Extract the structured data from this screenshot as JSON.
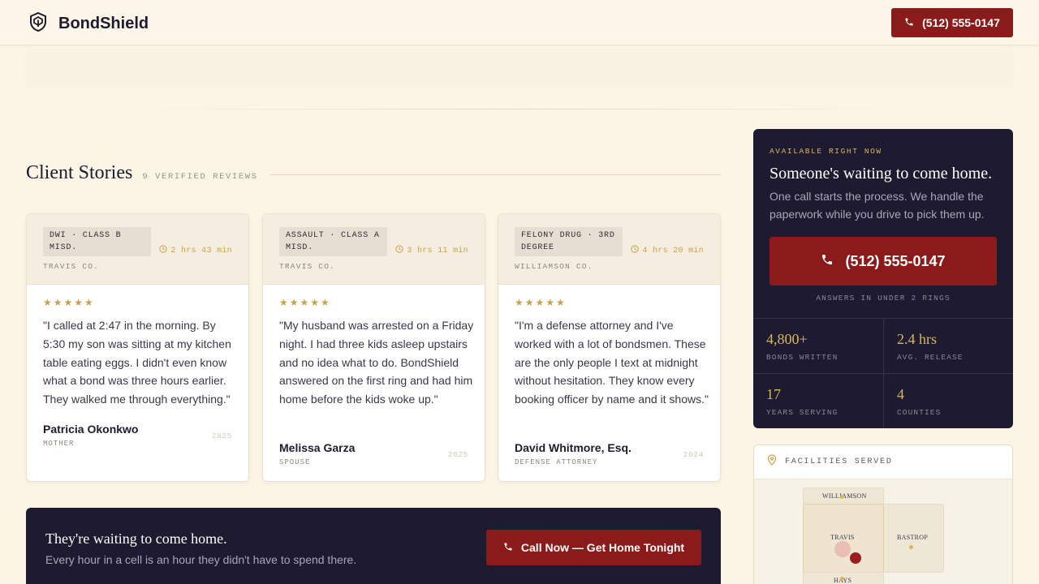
{
  "header": {
    "brand": "BondShield",
    "phone": "(512) 555-0147"
  },
  "reviews": {
    "title": "Client Stories",
    "count": "9 VERIFIED REVIEWS",
    "cards": [
      {
        "tag": "DWI · CLASS B MISD.",
        "time": "2 hrs 43 min",
        "county": "TRAVIS CO.",
        "stars": "★★★★★",
        "quote": "\"I called at 2:47 in the morning. By 5:30 my son was sitting at my kitchen table eating eggs. I didn't even know what a bond was three hours earlier. They walked me through everything.\"",
        "author": "Patricia Okonkwo",
        "role": "MOTHER",
        "year": "2025"
      },
      {
        "tag": "ASSAULT · CLASS A MISD.",
        "time": "3 hrs 11 min",
        "county": "TRAVIS CO.",
        "stars": "★★★★★",
        "quote": "\"My husband was arrested on a Friday night. I had three kids asleep upstairs and no idea what to do. BondShield answered on the first ring and had him home before the kids woke up.\"",
        "author": "Melissa Garza",
        "role": "SPOUSE",
        "year": "2025"
      },
      {
        "tag": "FELONY DRUG · 3RD DEGREE",
        "time": "4 hrs 20 min",
        "county": "WILLIAMSON CO.",
        "stars": "★★★★★",
        "quote": "\"I'm a defense attorney and I've worked with a lot of bondsmen. These are the only people I text at midnight without hesitation. They know every booking officer by name and it shows.\"",
        "author": "David Whitmore, Esq.",
        "role": "DEFENSE ATTORNEY",
        "year": "2024"
      }
    ]
  },
  "cta": {
    "title": "They're waiting to come home.",
    "subtitle": "Every hour in a cell is an hour they didn't have to spend there.",
    "button": "Call Now — Get Home Tonight"
  },
  "panel": {
    "eyebrow": "AVAILABLE RIGHT NOW",
    "title": "Someone's waiting to come home.",
    "subtitle": "One call starts the process. We handle the paperwork while you drive to pick them up.",
    "phone": "(512) 555-0147",
    "note": "ANSWERS IN UNDER 2 RINGS",
    "stats": [
      {
        "value": "4,800+",
        "label": "BONDS WRITTEN"
      },
      {
        "value": "2.4 hrs",
        "label": "AVG. RELEASE"
      },
      {
        "value": "17",
        "label": "YEARS SERVING"
      },
      {
        "value": "4",
        "label": "COUNTIES"
      }
    ]
  },
  "facilities": {
    "title": "FACILITIES SERVED",
    "counties": [
      "WILLIAMSON",
      "TRAVIS",
      "BASTROP",
      "HAYS"
    ]
  },
  "colors": {
    "accent_red": "#8b1a1a",
    "navy": "#1e1b31",
    "gold": "#c9a24a",
    "page_bg": "#fcf5e6"
  }
}
